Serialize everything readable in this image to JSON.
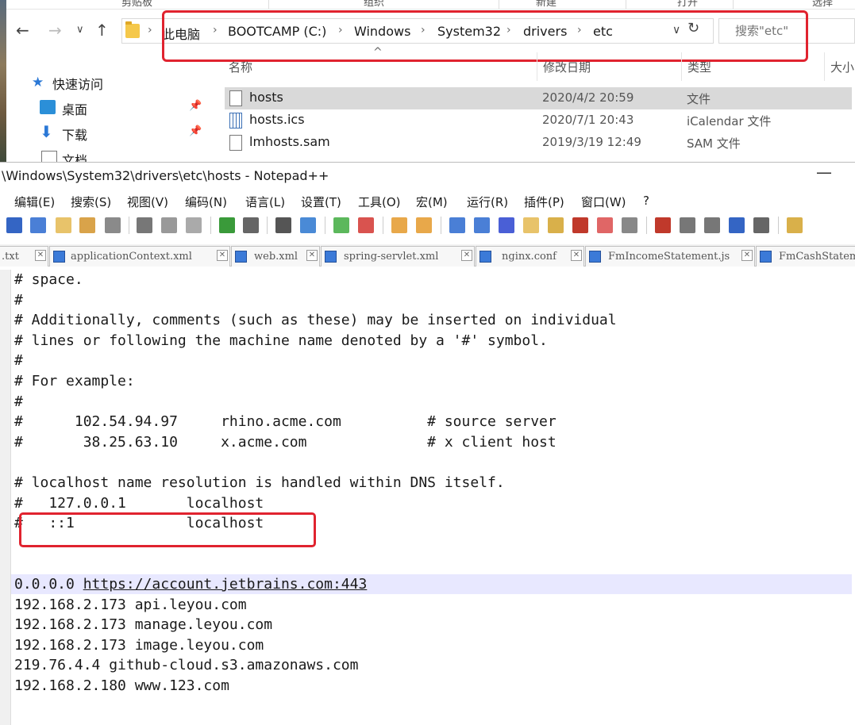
{
  "explorer": {
    "ribbon": [
      "剪贴板",
      "组织",
      "新建",
      "打开",
      "选择"
    ],
    "breadcrumb": [
      "此电脑",
      "BOOTCAMP (C:)",
      "Windows",
      "System32",
      "drivers",
      "etc"
    ],
    "search_placeholder": "搜索\"etc\"",
    "columns": {
      "name": "名称",
      "date": "修改日期",
      "type": "类型",
      "size": "大小"
    },
    "nav": [
      {
        "label": "快速访问"
      },
      {
        "label": "桌面"
      },
      {
        "label": "下载"
      },
      {
        "label": "文档"
      }
    ],
    "files": [
      {
        "name": "hosts",
        "date": "2020/4/2 20:59",
        "type": "文件",
        "selected": true
      },
      {
        "name": "hosts.ics",
        "date": "2020/7/1 20:43",
        "type": "iCalendar 文件",
        "selected": false
      },
      {
        "name": "lmhosts.sam",
        "date": "2019/3/19 12:49",
        "type": "SAM 文件",
        "selected": false
      }
    ]
  },
  "notepad": {
    "title": "\\Windows\\System32\\drivers\\etc\\hosts - Notepad++",
    "menu": [
      "编辑(E)",
      "搜索(S)",
      "视图(V)",
      "编码(N)",
      "语言(L)",
      "设置(T)",
      "工具(O)",
      "宏(M)",
      "运行(R)",
      "插件(P)",
      "窗口(W)",
      "?"
    ],
    "tabs": [
      ".txt",
      "applicationContext.xml",
      "web.xml",
      "spring-servlet.xml",
      "nginx.conf",
      "FmIncomeStatement.js",
      "FmCashStatement"
    ],
    "lines": [
      "# space.",
      "#",
      "# Additionally, comments (such as these) may be inserted on individual",
      "# lines or following the machine name denoted by a '#' symbol.",
      "#",
      "# For example:",
      "#",
      "#      102.54.94.97     rhino.acme.com          # source server",
      "#       38.25.63.10     x.acme.com              # x client host",
      "",
      "# localhost name resolution is handled within DNS itself.",
      "#   127.0.0.1       localhost",
      "#   ::1             localhost",
      "",
      "",
      "0.0.0.0 ",
      "192.168.2.173 api.leyou.com",
      "192.168.2.173 manage.leyou.com",
      "192.168.2.173 image.leyou.com",
      "219.76.4.4 github-cloud.s3.amazonaws.com",
      "192.168.2.180 www.123.com"
    ],
    "line16_link": "https://account.jetbrains.com:443"
  }
}
